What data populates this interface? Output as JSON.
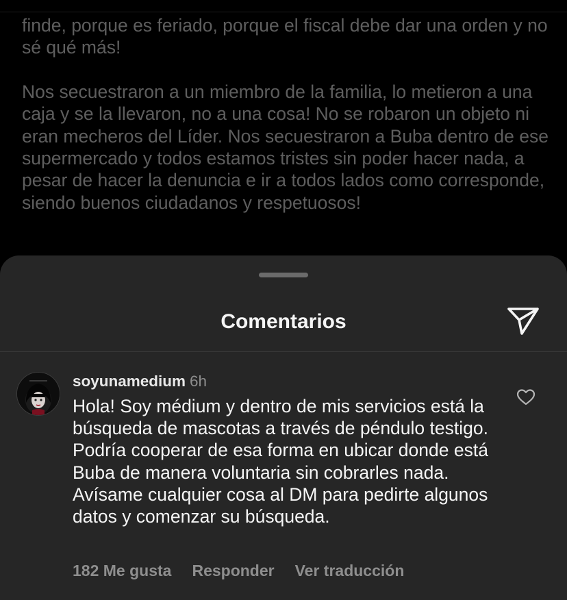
{
  "post": {
    "paragraph_1": "finde, porque es feriado, porque el fiscal debe dar una orden y no sé qué más!",
    "paragraph_2": "Nos secuestraron a un miembro de la familia, lo metieron a una caja y se la llevaron, no a una cosa! No se robaron un objeto ni eran mecheros del Líder. Nos secuestraron a Buba dentro de ese supermercado y todos estamos tristes sin poder hacer nada, a pesar de hacer la denuncia e ir a todos lados como corresponde, siendo buenos ciudadanos y respetuosos!"
  },
  "comments_sheet": {
    "title": "Comentarios",
    "share_icon": "paper-plane-icon"
  },
  "comment": {
    "username": "soyunamedium",
    "time": "6h",
    "avatar_icon": "avatar-illustration",
    "text": "Hola! Soy médium y dentro de mis servicios está la búsqueda de mascotas a través de péndulo testigo. Podría cooperar de esa forma en ubicar donde está Buba de manera voluntaria sin cobrarles nada. Avísame cualquier cosa al DM para pedirte algunos datos y comenzar su búsqueda.",
    "like_icon": "heart-icon",
    "likes": "182 Me gusta",
    "reply_label": "Responder",
    "translate_label": "Ver traducción"
  },
  "colors": {
    "background": "#000000",
    "sheet": "#262626",
    "text_primary": "#f5f5f5",
    "text_secondary": "#8e8e8e",
    "post_text_dimmed": "#5e5e5e"
  }
}
